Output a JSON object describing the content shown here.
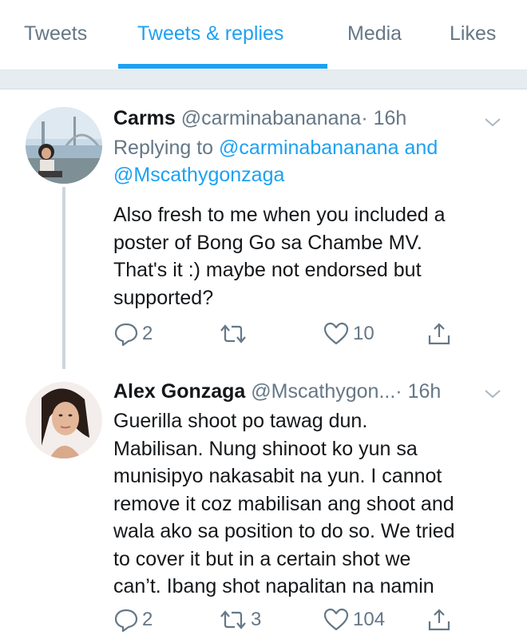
{
  "tabs": [
    {
      "label": "Tweets"
    },
    {
      "label": "Tweets & replies"
    },
    {
      "label": "Media"
    },
    {
      "label": "Likes"
    }
  ],
  "active_tab": "Tweets & replies",
  "tweets": [
    {
      "name": "Carms",
      "handle": "@carminabananana",
      "time": "· 16h",
      "replying_prefix": "Replying to ",
      "replying_user1": "@carminabananana",
      "replying_and": " and",
      "replying_user2": "@Mscathygonzaga",
      "text": "Also fresh to me when you included a\nposter of Bong Go sa Chambe MV.\nThat's it :) maybe not endorsed but\nsupported?",
      "replies": "2",
      "retweets": "",
      "likes": "10"
    },
    {
      "name": "Alex Gonzaga",
      "handle": "@Mscathygon...",
      "time": "· 16h",
      "text": "Guerilla shoot po tawag dun.\nMabilisan. Nung shinoot ko yun sa\nmunisipyo nakasabit na yun. I cannot\nremove it coz mabilisan ang shoot and\nwala ako sa position to do so. We tried\nto cover it but in a certain shot we\ncan’t. Ibang shot napalitan na namin",
      "replies": "2",
      "retweets": "3",
      "likes": "104"
    }
  ],
  "colors": {
    "accent": "#1da1f2",
    "secondary_text": "#657786",
    "primary_text": "#14171a",
    "divider": "#e6ecf0"
  },
  "icons": [
    "reply-icon",
    "retweet-icon",
    "like-icon",
    "share-icon",
    "chevron-down-icon"
  ]
}
